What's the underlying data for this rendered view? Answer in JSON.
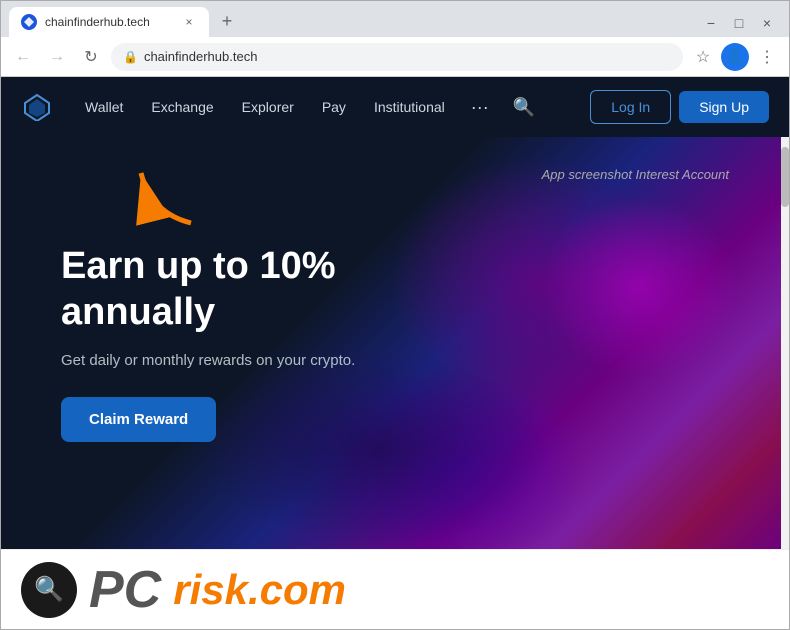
{
  "browser": {
    "tab": {
      "favicon": "◆",
      "title": "chainfinderhub.tech",
      "close_label": "×"
    },
    "new_tab_label": "+",
    "address": "chainfinderhub.tech",
    "nav": {
      "back_label": "←",
      "forward_label": "→",
      "reload_label": "↻"
    },
    "window_controls": {
      "minimize": "−",
      "maximize": "□",
      "close": "×"
    }
  },
  "site": {
    "logo_symbol": "◆",
    "nav": {
      "links": [
        "Wallet",
        "Exchange",
        "Explorer",
        "Pay",
        "Institutional"
      ],
      "dots": "···",
      "login_label": "Log In",
      "signup_label": "Sign Up"
    },
    "hero": {
      "screenshot_label": "App screenshot Interest Account",
      "title": "Earn up to 10% annually",
      "subtitle": "Get daily or monthly rewards on your crypto.",
      "cta_label": "Claim Reward"
    }
  },
  "watermark": {
    "icon": "🔍",
    "text_pc": "PC",
    "text_risk": "risk",
    "text_com": ".com"
  }
}
